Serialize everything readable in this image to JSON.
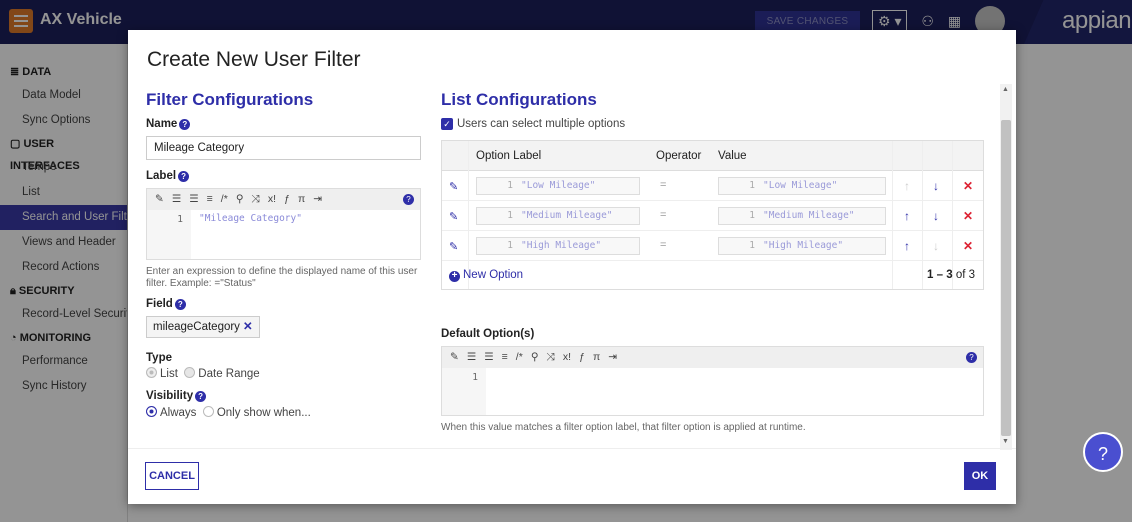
{
  "topbar": {
    "app_title": "AX Vehicle",
    "save_changes": "SAVE CHANGES",
    "logo_text": "appian"
  },
  "sidebar": {
    "sections": [
      {
        "header": "DATA",
        "items": [
          "Data Model",
          "Sync Options"
        ]
      },
      {
        "header": "USER INTERFACES",
        "items": [
          "Tempo",
          "List",
          "Search and User Filters",
          "Views and Header",
          "Record Actions"
        ]
      },
      {
        "header": "SECURITY",
        "items": [
          "Record-Level Security"
        ]
      },
      {
        "header": "MONITORING",
        "items": [
          "Performance",
          "Sync History"
        ]
      }
    ],
    "active_item": "Search and User Filters"
  },
  "dialog": {
    "title": "Create New User Filter",
    "filter_config": {
      "section_title": "Filter Configurations",
      "name_label": "Name",
      "name_value": "Mileage Category",
      "label_label": "Label",
      "label_line_no": "1",
      "label_code": "\"Mileage Category\"",
      "label_hint": "Enter an expression to define the displayed name of this user filter. Example: =\"Status\"",
      "field_label": "Field",
      "field_value": "mileageCategory",
      "type_label": "Type",
      "type_options": [
        "List",
        "Date Range"
      ],
      "visibility_label": "Visibility",
      "visibility_options": [
        "Always",
        "Only show when..."
      ]
    },
    "list_config": {
      "section_title": "List Configurations",
      "multi_select_label": "Users can select multiple options",
      "columns": [
        "Option Label",
        "Operator",
        "Value"
      ],
      "rows": [
        {
          "label": "\"Low Mileage\"",
          "operator": "=",
          "value": "\"Low Mileage\"",
          "line": "1"
        },
        {
          "label": "\"Medium Mileage\"",
          "operator": "=",
          "value": "\"Medium Mileage\"",
          "line": "1"
        },
        {
          "label": "\"High Mileage\"",
          "operator": "=",
          "value": "\"High Mileage\"",
          "line": "1"
        }
      ],
      "new_option": "New Option",
      "pager_range": "1 – 3",
      "pager_of": "of 3",
      "default_label": "Default Option(s)",
      "default_line_no": "1",
      "default_hint": "When this value matches a filter option label, that filter option is applied at runtime."
    },
    "cancel_label": "CANCEL",
    "ok_label": "OK"
  },
  "colors": {
    "accent": "#2e2ea8",
    "topbar": "#1d1f5c",
    "delete": "#dd2233"
  }
}
